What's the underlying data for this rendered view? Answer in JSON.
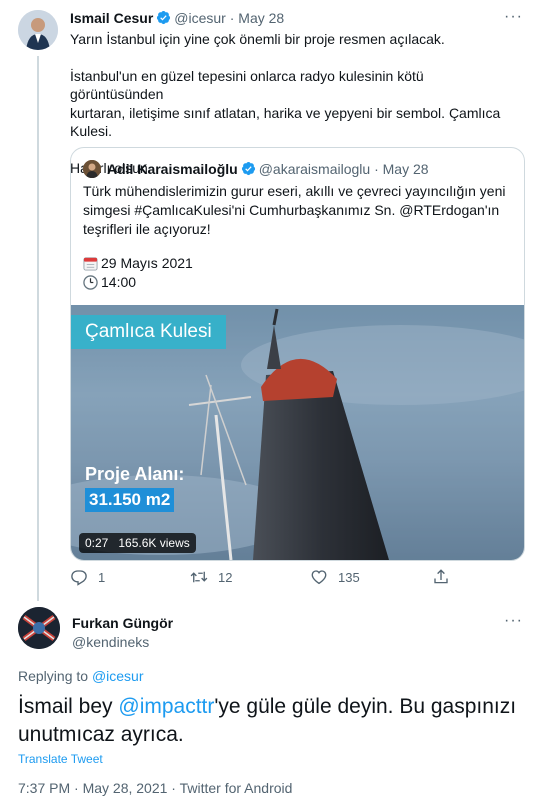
{
  "tweet1": {
    "author_name": "Ismail Cesur",
    "handle": "@icesur",
    "date": "May 28",
    "separator": "·",
    "more": "···",
    "body": [
      [
        "Yarın İstanbul için yine çok önemli bir proje resmen açılacak."
      ],
      [
        "İstanbul'un en güzel tepesini onlarca radyo kulesinin kötü görüntüsünden",
        "kurtaran, iletişime sınıf atlatan, harika ve yepyeni bir sembol. Çamlıca Kulesi."
      ],
      [
        "Hayırlı olsun."
      ]
    ],
    "quote": {
      "author_name": "Adil Karaismailoğlu",
      "handle": "@akaraismailoglu",
      "date": "May 28",
      "separator": "·",
      "line1": "Türk mühendislerimizin gurur eseri, akıllı ve çevreci yayıncılığın yeni",
      "line2_text": "simgesi #ÇamlıcaKulesi'ni Cumhurbaşkanımız Sn. ",
      "line2_mention": "@RTErdogan",
      "line2_tail": "'ın",
      "line3": "teşrifleri ile açıyoruz!",
      "date_line": "29 Mayıs 2021",
      "time_line": "14:00",
      "video": {
        "badge": "Çamlıca Kulesi",
        "area_label": "Proje Alanı:",
        "area_value": "31.150 m2",
        "duration": "0:27",
        "views": "165.6K views"
      }
    },
    "actions": {
      "reply_count": "1",
      "retweet_count": "12",
      "like_count": "135"
    }
  },
  "tweet2": {
    "author_name": "Furkan Güngör",
    "handle": "@kendineks",
    "more": "···",
    "replying_prefix": "Replying to ",
    "replying_to": "@icesur",
    "body_prefix": "İsmail bey ",
    "body_mention": "@impacttr",
    "body_rest_line1": "'ye güle güle deyin. Bu gaspınızı",
    "body_line2": "unutmıcaz ayrıca.",
    "translate": "Translate Tweet",
    "meta": "7:37 PM · May 28, 2021 · Twitter for Android"
  },
  "colors": {
    "accent": "#1d9bf0",
    "text": "#0f1419",
    "muted": "#536471",
    "border": "#cfd9de"
  },
  "icons": [
    "verified-badge-icon",
    "calendar-icon",
    "clock-icon",
    "reply-icon",
    "retweet-icon",
    "like-icon",
    "share-icon",
    "more-icon"
  ]
}
